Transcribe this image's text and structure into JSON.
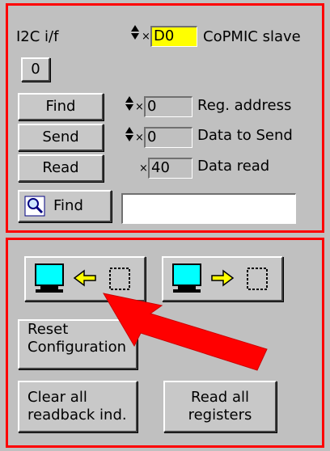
{
  "i2c": {
    "label": "I2C i/f",
    "index_value": "0",
    "slave_prefix": "×",
    "slave_value": "D0",
    "slave_label": "CoPMIC slave"
  },
  "buttons": {
    "find": "Find",
    "send": "Send",
    "read": "Read",
    "search_find": "Find"
  },
  "fields": {
    "reg_prefix": "×",
    "reg_value": "0",
    "reg_label": "Reg. address",
    "send_prefix": "×",
    "send_value": "0",
    "send_label": "Data to Send",
    "read_prefix": "×",
    "read_value": "40",
    "read_label": "Data read",
    "search_value": ""
  },
  "bottom": {
    "reset_line1": "Reset",
    "reset_line2": "Configuration",
    "clear_line1": "Clear all",
    "clear_line2": "readback ind.",
    "readall_line1": "Read all",
    "readall_line2": "registers"
  },
  "colors": {
    "panel_border": "#ff0000",
    "slave_field": "#ffff00",
    "monitor_screen": "#00ffff",
    "arrow_yellow": "#ffff00",
    "annotation_arrow": "#ff0000"
  },
  "icons": {
    "search": "magnifier-icon",
    "annotation": "red-arrow-icon"
  }
}
